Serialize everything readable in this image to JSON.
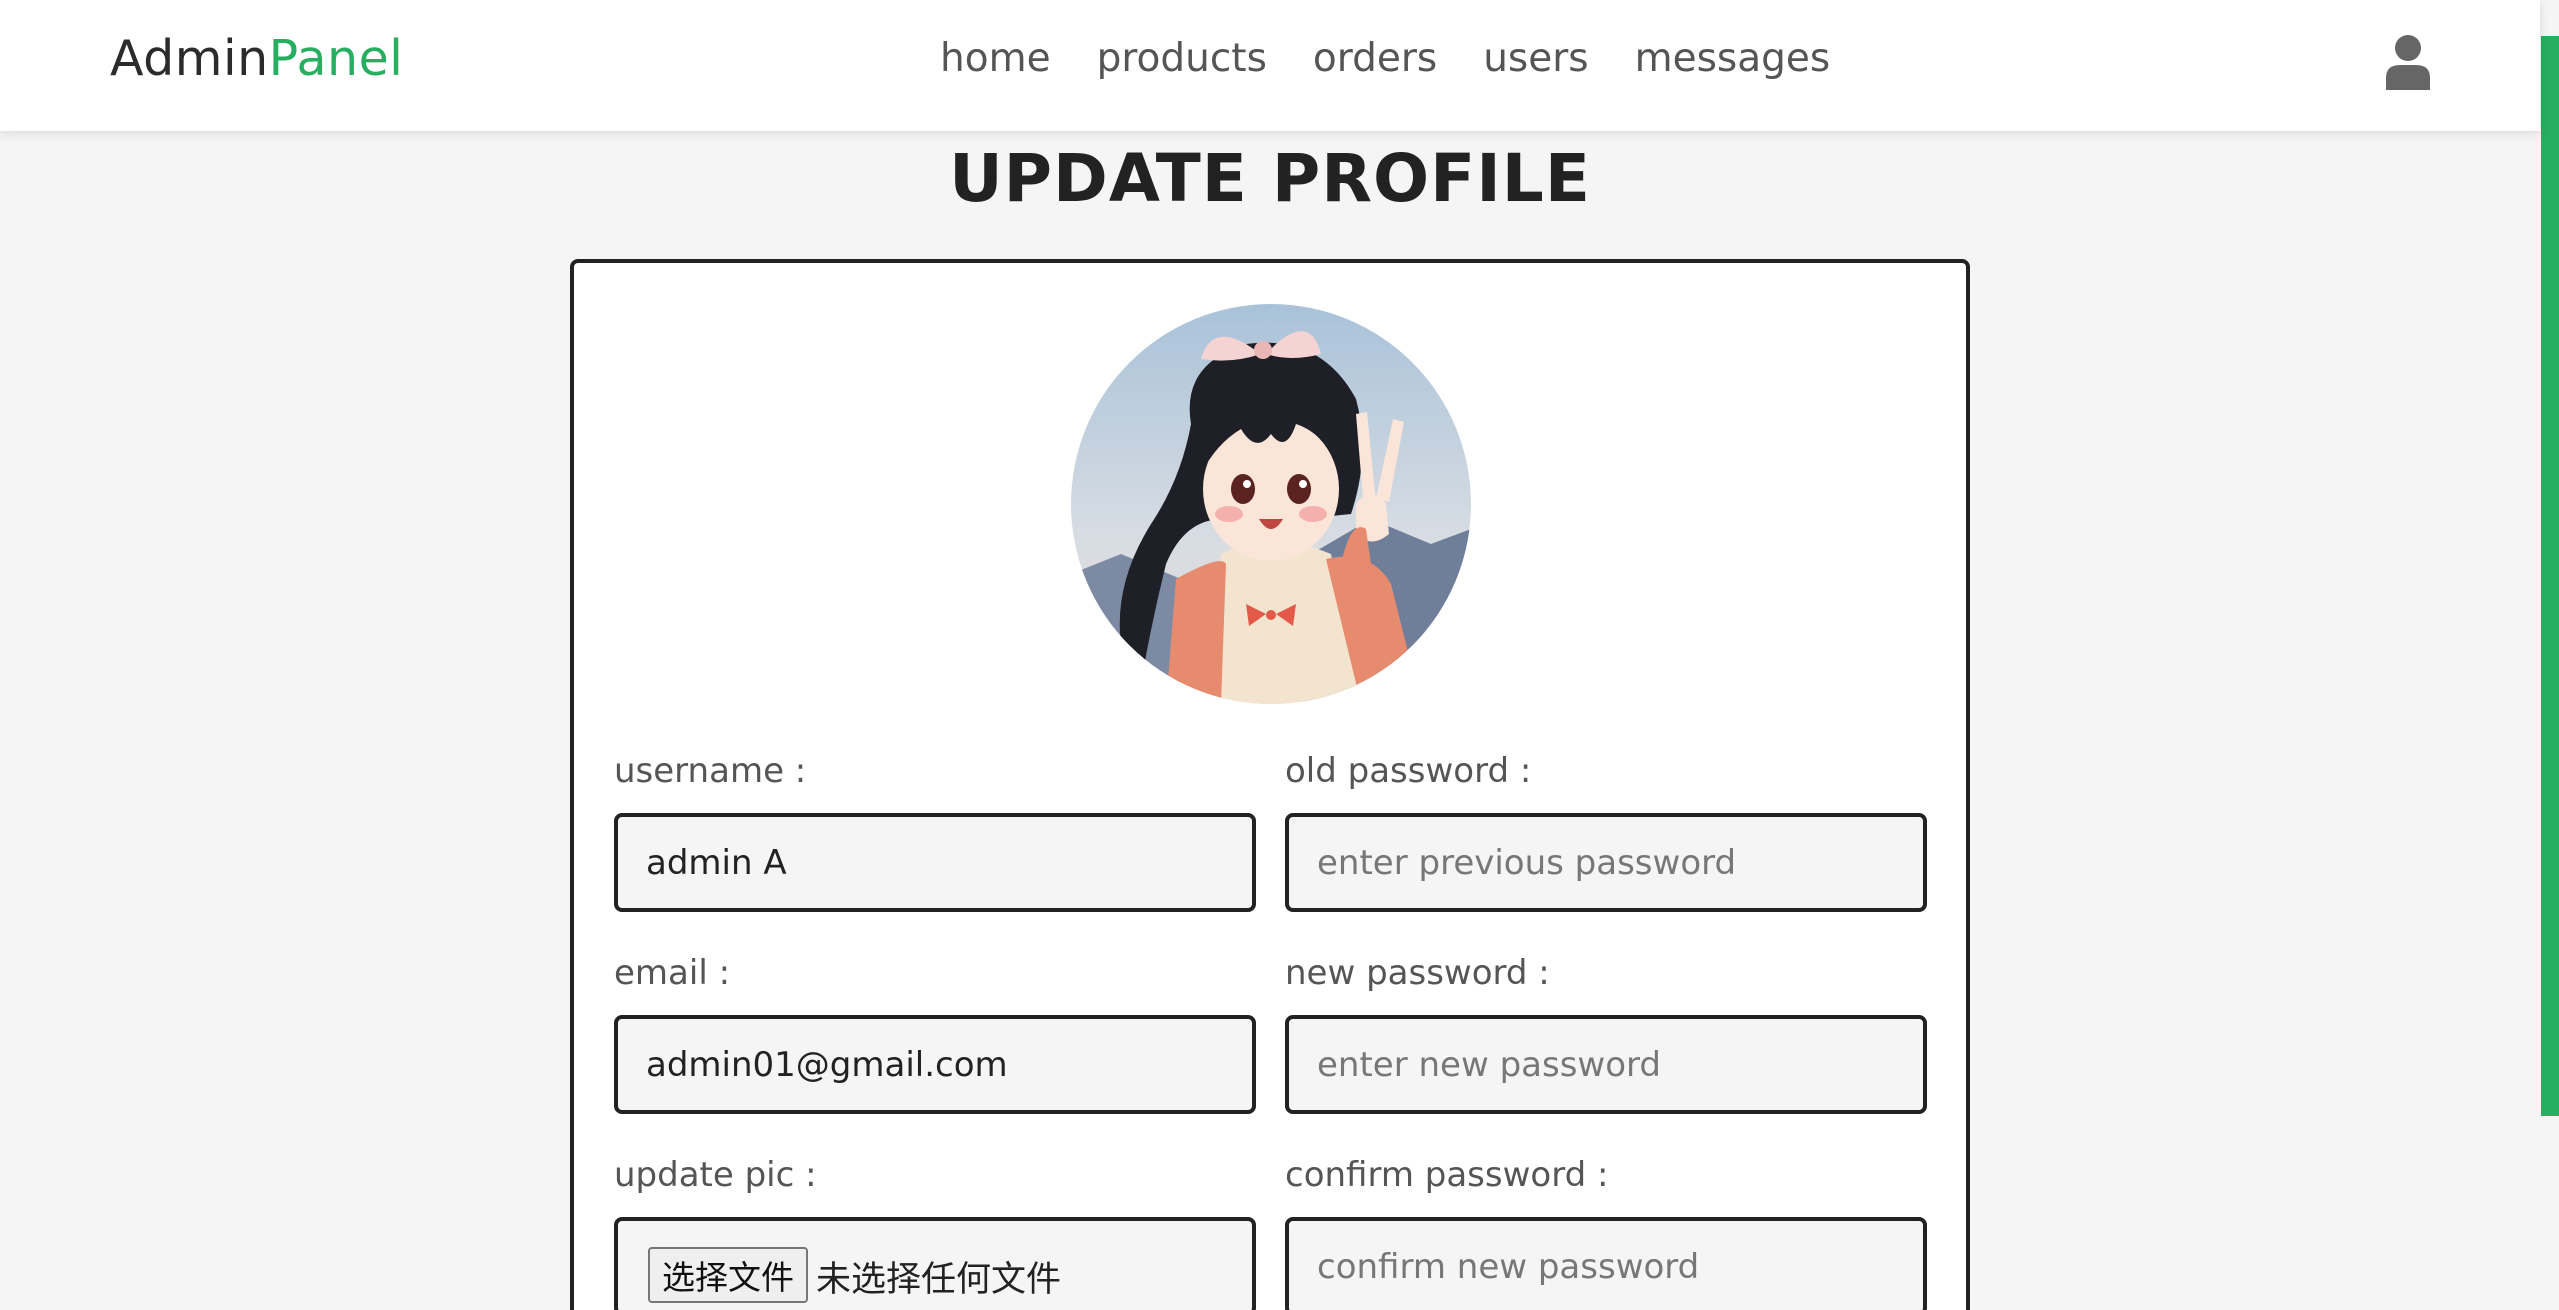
{
  "header": {
    "logo_main": "Admin",
    "logo_accent": "Panel",
    "nav": [
      {
        "label": "home"
      },
      {
        "label": "products"
      },
      {
        "label": "orders"
      },
      {
        "label": "users"
      },
      {
        "label": "messages"
      }
    ],
    "user_icon": "user-icon"
  },
  "page": {
    "title": "UPDATE PROFILE"
  },
  "profile": {
    "avatar_icon": "profile-avatar-image",
    "username_label": "username :",
    "username_value": "admin A",
    "email_label": "email :",
    "email_value": "admin01@gmail.com",
    "pic_label": "update pic :",
    "file_button": "选择文件",
    "file_status": "未选择任何文件",
    "old_password_label": "old password :",
    "old_password_placeholder": "enter previous password",
    "new_password_label": "new password :",
    "new_password_placeholder": "enter new password",
    "confirm_password_label": "confirm password :",
    "confirm_password_placeholder": "confirm new password"
  },
  "colors": {
    "accent": "#27ae60",
    "background": "#f5f5f5",
    "border": "#222222"
  }
}
